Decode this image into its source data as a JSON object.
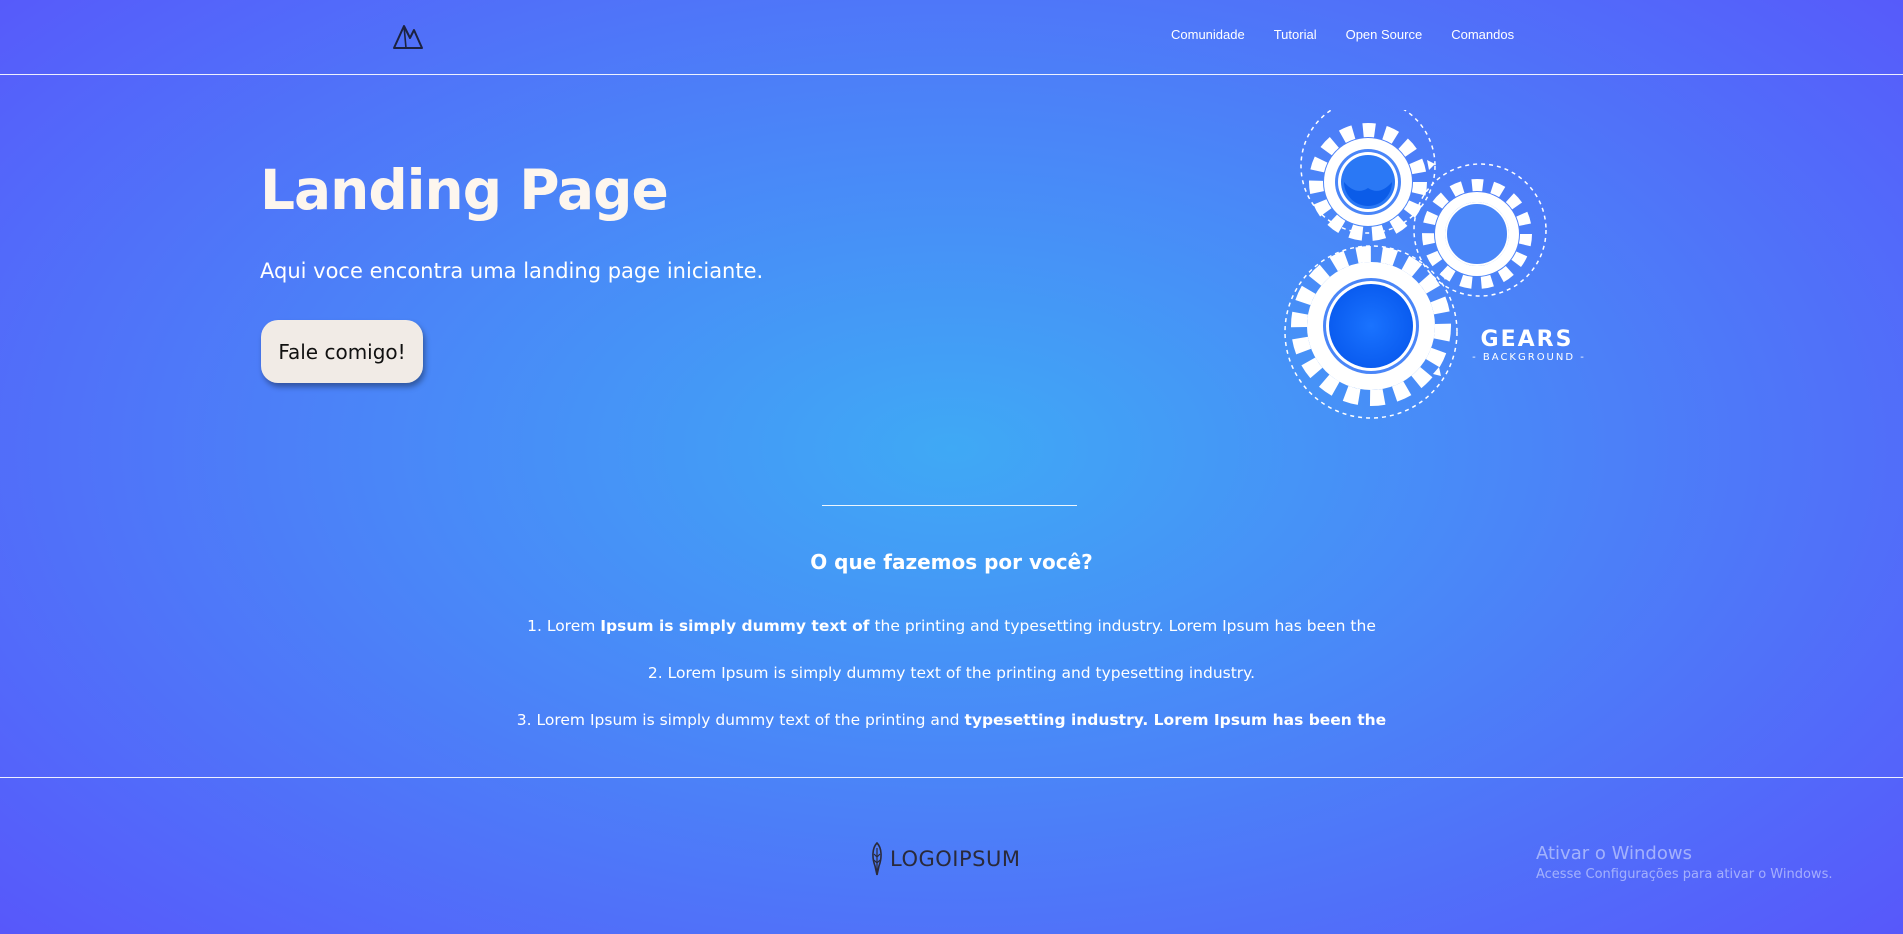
{
  "header": {
    "logo_icon": "mountain-logo-icon",
    "nav": [
      "Comunidade",
      "Tutorial",
      "Open Source",
      "Comandos"
    ]
  },
  "hero": {
    "title": "Landing Page",
    "subtitle": "Aqui voce encontra uma landing page iniciante.",
    "cta_label": "Fale comigo!",
    "illustration": {
      "icon": "gears-illustration",
      "title": "GEARS",
      "subtitle": "- BACKGROUND -"
    }
  },
  "section": {
    "title": "O que fazemos por você?",
    "items": [
      {
        "pre": "1. Lorem ",
        "bold": "Ipsum is simply dummy text of",
        "post": " the printing and typesetting industry. Lorem Ipsum has been the"
      },
      {
        "pre": "2. Lorem Ipsum is simply dummy text of the printing and typesetting industry.",
        "bold": "",
        "post": ""
      },
      {
        "pre": "3. Lorem Ipsum is simply dummy text of the printing and ",
        "bold": "typesetting industry. Lorem Ipsum has been the",
        "post": ""
      }
    ]
  },
  "footer": {
    "logo_icon": "feather-logo-icon",
    "logo_text": "LOGOIPSUM"
  },
  "watermark": {
    "line1": "Ativar o Windows",
    "line2": "Acesse Configurações para ativar o Windows."
  },
  "colors": {
    "bg_center": "#3fa9f5",
    "bg_edge": "#5a4ffb",
    "button_bg": "#f1ebe6",
    "title_color": "#fdf6ee"
  }
}
